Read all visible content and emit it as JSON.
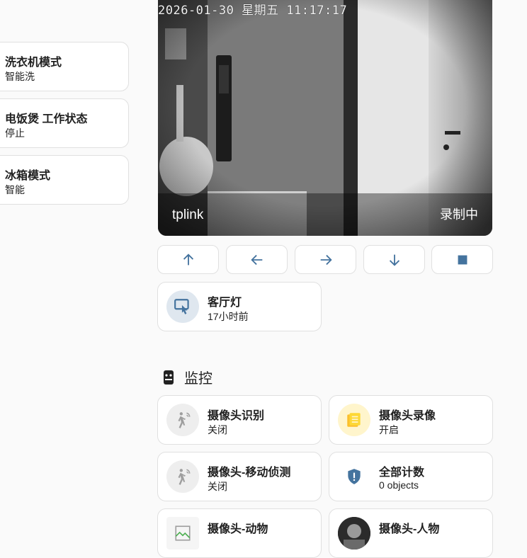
{
  "left_tiles": [
    {
      "title": "洗衣机模式",
      "state": "智能洗"
    },
    {
      "title": "电饭煲 工作状态",
      "state": "停止"
    },
    {
      "title": "冰箱模式",
      "state": "智能"
    }
  ],
  "camera": {
    "timestamp": "2026-01-30 星期五 11:17:17",
    "name": "tplink",
    "status": "录制中"
  },
  "ptz_controls": [
    {
      "icon": "arrow-up-icon"
    },
    {
      "icon": "arrow-left-icon"
    },
    {
      "icon": "arrow-right-icon"
    },
    {
      "icon": "arrow-down-icon"
    },
    {
      "icon": "stop-icon"
    }
  ],
  "living_light": {
    "title": "客厅灯",
    "state": "17小时前",
    "icon": "gesture-tap-icon"
  },
  "section": {
    "title": "监控",
    "icon": "cctv-icon"
  },
  "monitor_tiles": [
    {
      "title": "摄像头识别",
      "state": "关闭",
      "icon": "motion-sensor-icon"
    },
    {
      "title": "摄像头录像",
      "state": "开启",
      "icon": "record-list-icon"
    },
    {
      "title": "摄像头-移动侦测",
      "state": "关闭",
      "icon": "motion-sensor-icon"
    },
    {
      "title": "全部计数",
      "state": "0 objects",
      "icon": "shield-alert-icon"
    },
    {
      "title": "摄像头-动物",
      "state": "",
      "icon": "broken-image-icon"
    },
    {
      "title": "摄像头-人物",
      "state": "",
      "icon": "person-thumbnail-icon"
    }
  ],
  "colors": {
    "accent": "#44739e",
    "recording_active": "#fdd835",
    "icon_off": "#9e9e9e"
  }
}
